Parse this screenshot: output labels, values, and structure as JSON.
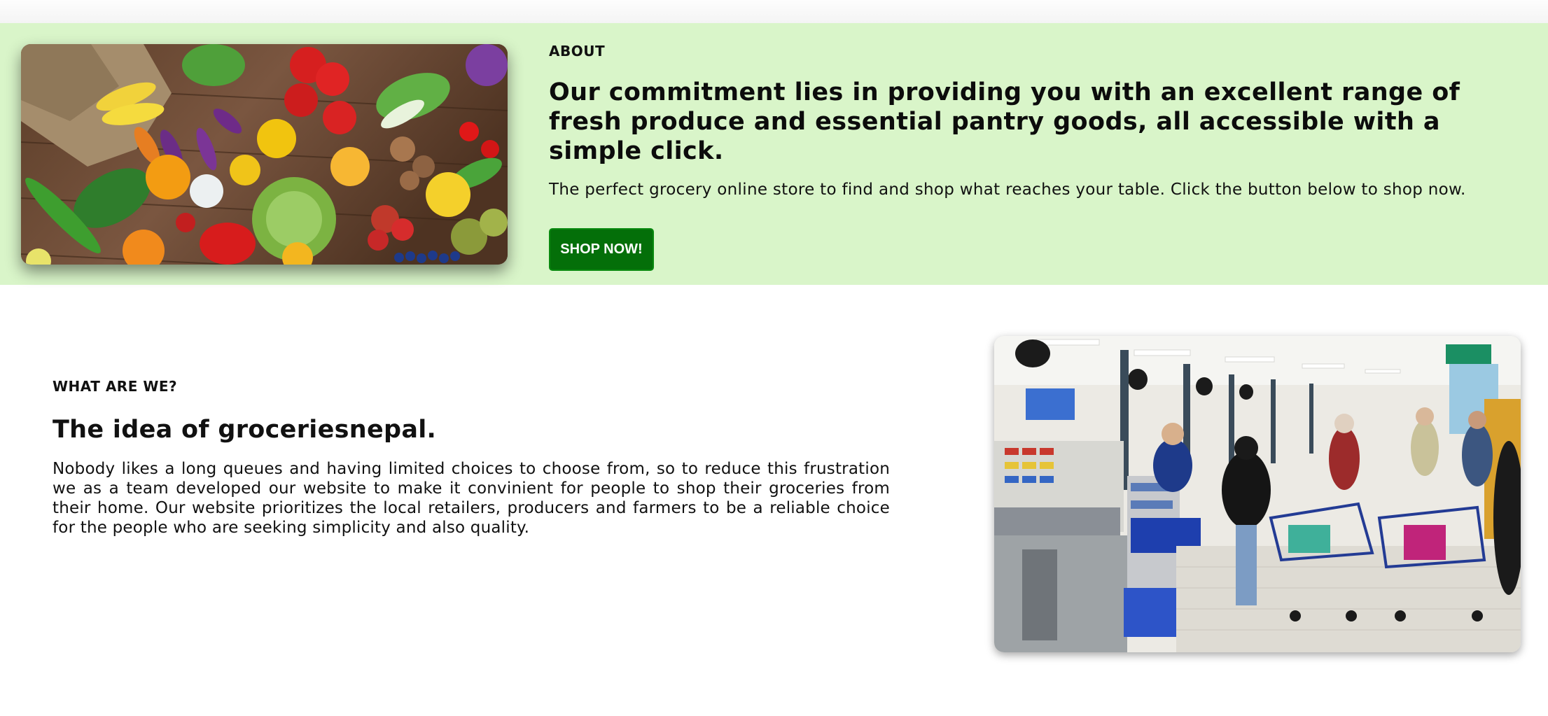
{
  "about": {
    "eyebrow": "ABOUT",
    "title": "Our commitment lies in providing you with an excellent range of fresh produce and essential pantry goods, all accessible with a simple click.",
    "description": "The perfect grocery online store to find and shop what reaches your table. Click the button below to shop now.",
    "button_label": "SHOP NOW!",
    "image_name": "fresh-produce-photo"
  },
  "what": {
    "eyebrow": "WHAT ARE WE?",
    "title": "The idea of groceriesnepal.",
    "description": "Nobody likes a long queues and having limited choices to choose from, so to reduce this frustration we as a team developed our website to make it convinient for people to shop their groceries from their home. Our website prioritizes the local retailers, producers and farmers to be a reliable choice for the people who are seeking simplicity and also quality.",
    "image_name": "supermarket-checkout-photo"
  },
  "colors": {
    "about_background": "#d9f5c9",
    "button_background": "#046f09",
    "button_text": "#ffffff"
  }
}
